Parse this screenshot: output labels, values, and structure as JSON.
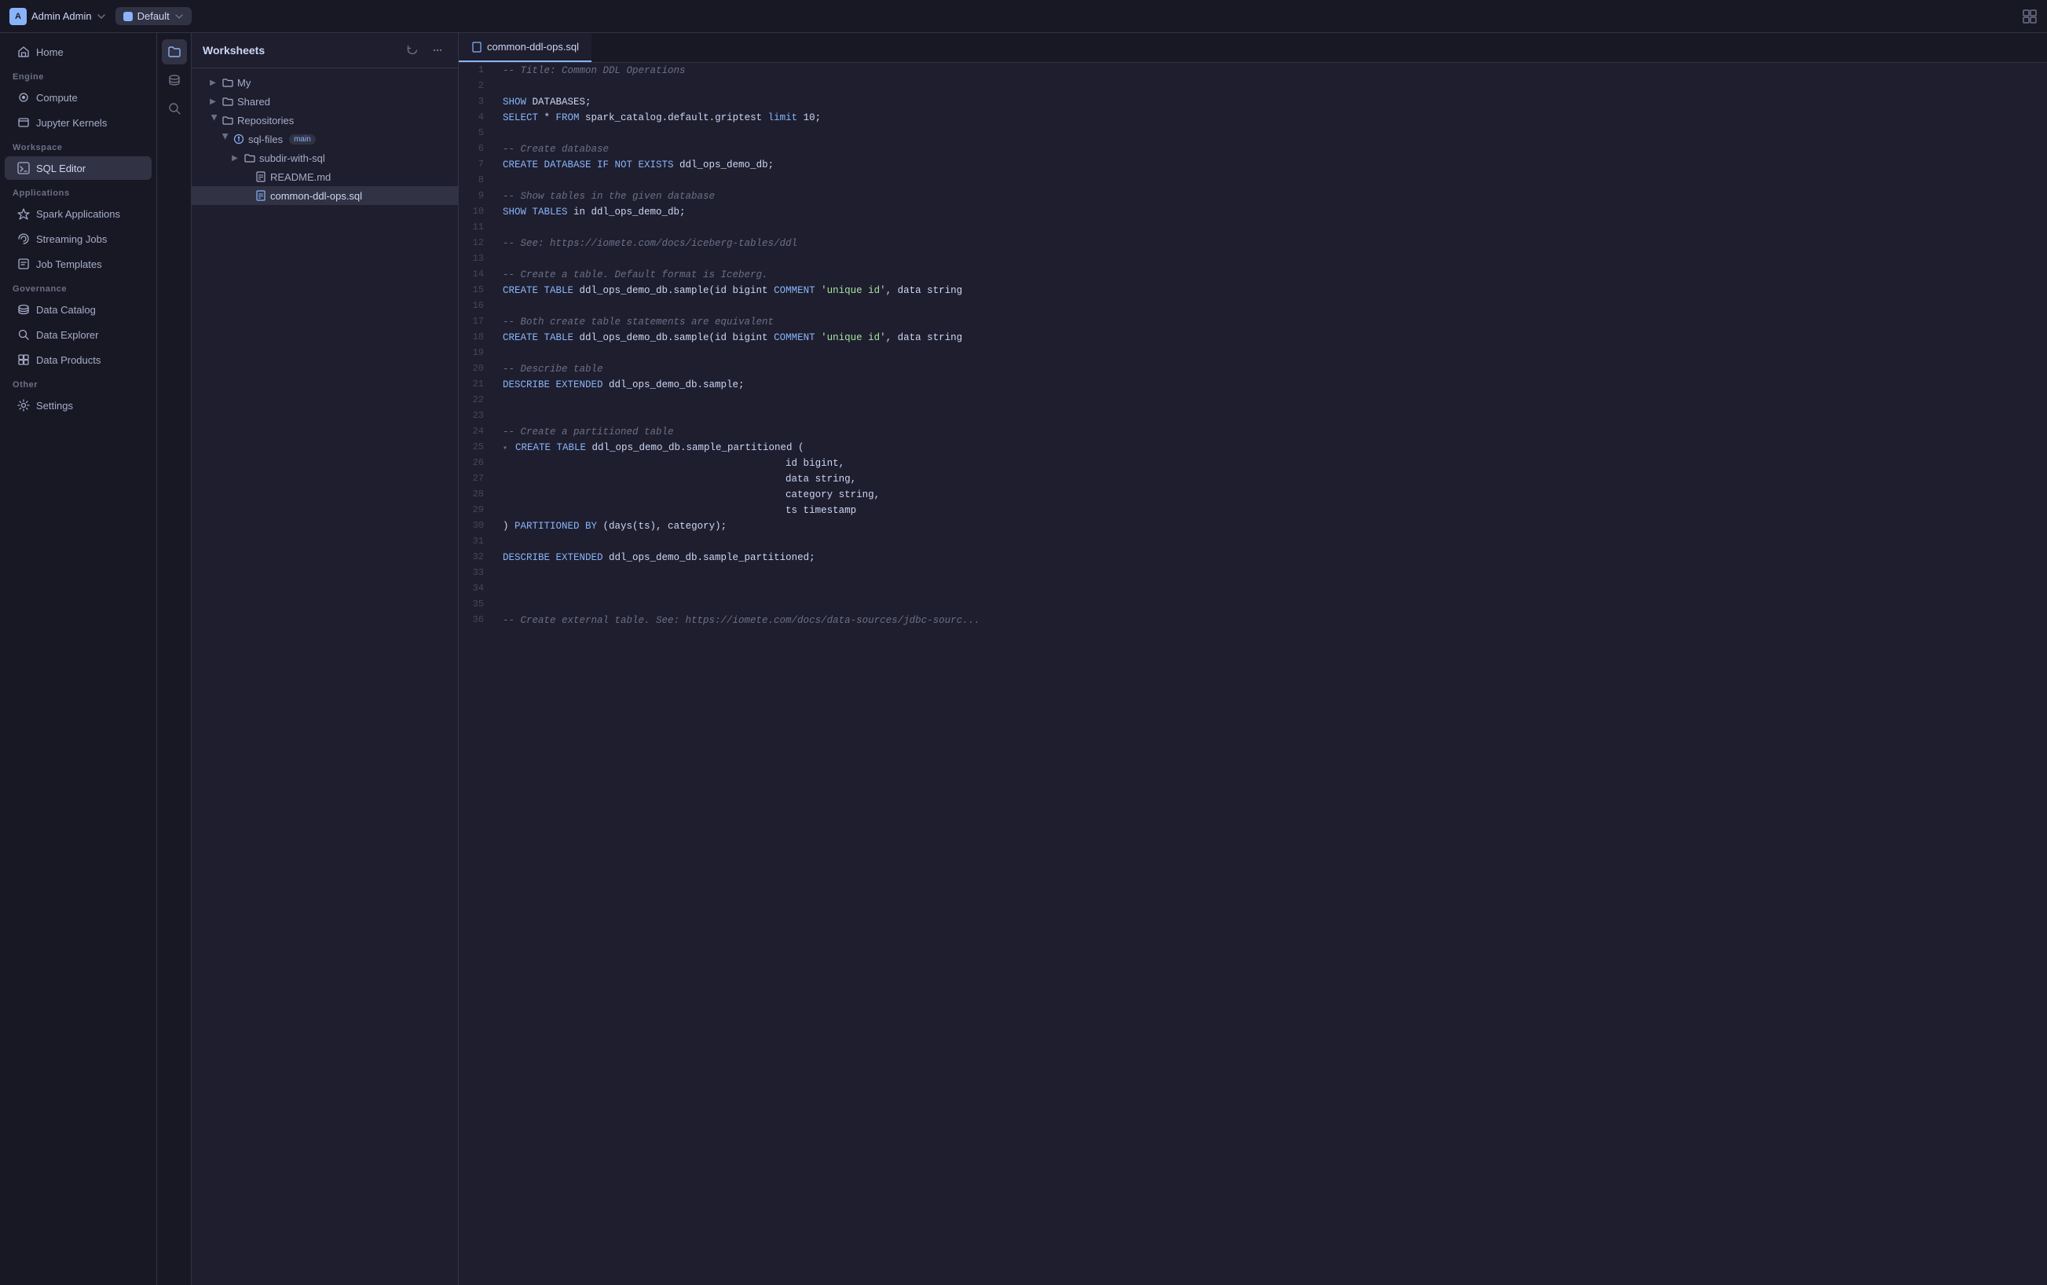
{
  "topbar": {
    "user_label": "Admin Admin",
    "user_initial": "A",
    "workspace_label": "Default",
    "layout_toggle": "layout-icon"
  },
  "icon_sidebar": {
    "items": [
      {
        "name": "files-icon",
        "label": "Files",
        "active": true
      },
      {
        "name": "database-icon",
        "label": "Database",
        "active": false
      },
      {
        "name": "search-icon",
        "label": "Search",
        "active": false
      }
    ]
  },
  "left_sidebar": {
    "home_label": "Home",
    "engine_section": "Engine",
    "compute_label": "Compute",
    "jupyter_label": "Jupyter Kernels",
    "workspace_section": "Workspace",
    "sql_editor_label": "SQL Editor",
    "applications_section": "Applications",
    "spark_applications_label": "Spark Applications",
    "streaming_jobs_label": "Streaming Jobs",
    "job_templates_label": "Job Templates",
    "governance_section": "Governance",
    "data_catalog_label": "Data Catalog",
    "data_explorer_label": "Data Explorer",
    "data_products_label": "Data Products",
    "other_section": "Other",
    "settings_label": "Settings"
  },
  "file_tree": {
    "panel_title": "Worksheets",
    "refresh_icon": "refresh-icon",
    "more_icon": "more-icon",
    "items": [
      {
        "label": "My",
        "type": "folder",
        "indent": 1,
        "expanded": false
      },
      {
        "label": "Shared",
        "type": "folder",
        "indent": 1,
        "expanded": false
      },
      {
        "label": "Repositories",
        "type": "folder",
        "indent": 1,
        "expanded": true
      },
      {
        "label": "sql-files",
        "type": "git",
        "indent": 2,
        "expanded": true,
        "badge": "main"
      },
      {
        "label": "subdir-with-sql",
        "type": "folder",
        "indent": 3,
        "expanded": false
      },
      {
        "label": "README.md",
        "type": "file-md",
        "indent": 4,
        "expanded": false
      },
      {
        "label": "common-ddl-ops.sql",
        "type": "file-sql",
        "indent": 4,
        "expanded": false,
        "active": true
      }
    ]
  },
  "editor": {
    "tab_filename": "common-ddl-ops.sql",
    "tab_icon": "sql-file-icon",
    "lines": [
      {
        "num": 1,
        "tokens": [
          {
            "text": "-- Title: Common DDL Operations",
            "class": "c-comment"
          }
        ]
      },
      {
        "num": 2,
        "tokens": []
      },
      {
        "num": 3,
        "tokens": [
          {
            "text": "SHOW",
            "class": "c-keyword"
          },
          {
            "text": " DATABASES;",
            "class": "c-plain"
          }
        ]
      },
      {
        "num": 4,
        "tokens": [
          {
            "text": "SELECT",
            "class": "c-keyword"
          },
          {
            "text": " * ",
            "class": "c-plain"
          },
          {
            "text": "FROM",
            "class": "c-keyword"
          },
          {
            "text": " spark_catalog.default.griptest ",
            "class": "c-plain"
          },
          {
            "text": "limit",
            "class": "c-keyword"
          },
          {
            "text": " 10;",
            "class": "c-plain"
          }
        ]
      },
      {
        "num": 5,
        "tokens": []
      },
      {
        "num": 6,
        "tokens": [
          {
            "text": "-- Create database",
            "class": "c-comment"
          }
        ]
      },
      {
        "num": 7,
        "tokens": [
          {
            "text": "CREATE DATABASE IF NOT EXISTS",
            "class": "c-keyword"
          },
          {
            "text": " ddl_ops_demo_db;",
            "class": "c-plain"
          }
        ]
      },
      {
        "num": 8,
        "tokens": []
      },
      {
        "num": 9,
        "tokens": [
          {
            "text": "-- Show tables in the given database",
            "class": "c-comment"
          }
        ]
      },
      {
        "num": 10,
        "tokens": [
          {
            "text": "SHOW TABLES",
            "class": "c-keyword"
          },
          {
            "text": " in ddl_ops_demo_db;",
            "class": "c-plain"
          }
        ]
      },
      {
        "num": 11,
        "tokens": []
      },
      {
        "num": 12,
        "tokens": [
          {
            "text": "-- See: https://iomete.com/docs/iceberg-tables/ddl",
            "class": "c-comment"
          }
        ]
      },
      {
        "num": 13,
        "tokens": []
      },
      {
        "num": 14,
        "tokens": [
          {
            "text": "-- Create a table. Default format is Iceberg.",
            "class": "c-comment"
          }
        ]
      },
      {
        "num": 15,
        "tokens": [
          {
            "text": "CREATE TABLE",
            "class": "c-keyword"
          },
          {
            "text": " ddl_ops_demo_db.sample(id bigint ",
            "class": "c-plain"
          },
          {
            "text": "COMMENT",
            "class": "c-keyword"
          },
          {
            "text": " ",
            "class": "c-plain"
          },
          {
            "text": "'unique id'",
            "class": "c-string"
          },
          {
            "text": ", data string",
            "class": "c-plain"
          }
        ]
      },
      {
        "num": 16,
        "tokens": []
      },
      {
        "num": 17,
        "tokens": [
          {
            "text": "-- Both create table statements are equivalent",
            "class": "c-comment"
          }
        ]
      },
      {
        "num": 18,
        "tokens": [
          {
            "text": "CREATE TABLE",
            "class": "c-keyword"
          },
          {
            "text": " ddl_ops_demo_db.sample(id bigint ",
            "class": "c-plain"
          },
          {
            "text": "COMMENT",
            "class": "c-keyword"
          },
          {
            "text": " ",
            "class": "c-plain"
          },
          {
            "text": "'unique id'",
            "class": "c-string"
          },
          {
            "text": ", data string",
            "class": "c-plain"
          }
        ]
      },
      {
        "num": 19,
        "tokens": []
      },
      {
        "num": 20,
        "tokens": [
          {
            "text": "-- Describe table",
            "class": "c-comment"
          }
        ]
      },
      {
        "num": 21,
        "tokens": [
          {
            "text": "DESCRIBE EXTENDED",
            "class": "c-keyword"
          },
          {
            "text": " ddl_ops_demo_db.sample;",
            "class": "c-plain"
          }
        ]
      },
      {
        "num": 22,
        "tokens": []
      },
      {
        "num": 23,
        "tokens": []
      },
      {
        "num": 24,
        "tokens": [
          {
            "text": "-- Create a partitioned table",
            "class": "c-comment"
          }
        ]
      },
      {
        "num": 25,
        "tokens": [
          {
            "text": "CREATE TABLE",
            "class": "c-keyword"
          },
          {
            "text": " ddl_ops_demo_db.sample_partitioned (",
            "class": "c-plain"
          }
        ],
        "foldable": true
      },
      {
        "num": 26,
        "tokens": [
          {
            "text": "                                                id bigint,",
            "class": "c-plain"
          }
        ]
      },
      {
        "num": 27,
        "tokens": [
          {
            "text": "                                                data string,",
            "class": "c-plain"
          }
        ]
      },
      {
        "num": 28,
        "tokens": [
          {
            "text": "                                                category string,",
            "class": "c-plain"
          }
        ]
      },
      {
        "num": 29,
        "tokens": [
          {
            "text": "                                                ts timestamp",
            "class": "c-plain"
          }
        ]
      },
      {
        "num": 30,
        "tokens": [
          {
            "text": ") ",
            "class": "c-plain"
          },
          {
            "text": "PARTITIONED BY",
            "class": "c-keyword"
          },
          {
            "text": " (days(ts), category);",
            "class": "c-plain"
          }
        ]
      },
      {
        "num": 31,
        "tokens": []
      },
      {
        "num": 32,
        "tokens": [
          {
            "text": "DESCRIBE EXTENDED",
            "class": "c-keyword"
          },
          {
            "text": " ddl_ops_demo_db.sample_partitioned;",
            "class": "c-plain"
          }
        ]
      },
      {
        "num": 33,
        "tokens": []
      },
      {
        "num": 34,
        "tokens": []
      },
      {
        "num": 35,
        "tokens": []
      },
      {
        "num": 36,
        "tokens": [
          {
            "text": "-- Create external table. See: https://iomete.com/docs/data-sources/jdbc-sourc...",
            "class": "c-comment"
          }
        ]
      }
    ]
  },
  "colors": {
    "bg_primary": "#1e1e2e",
    "bg_secondary": "#181825",
    "accent": "#89b4fa",
    "border": "#313244",
    "text_primary": "#cdd6f4",
    "text_muted": "#6c7086"
  }
}
